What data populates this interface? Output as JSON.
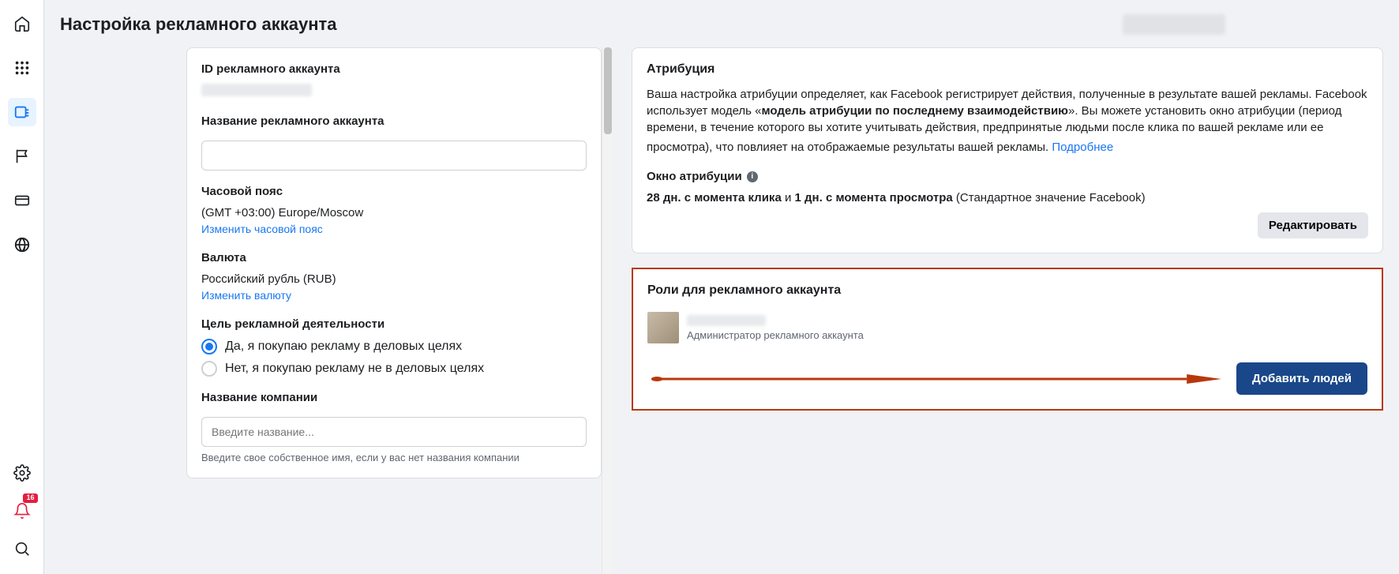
{
  "page_title": "Настройка рекламного аккаунта",
  "badge_count": "16",
  "left": {
    "id_label": "ID рекламного аккаунта",
    "name_label": "Название рекламного аккаунта",
    "tz_label": "Часовой пояс",
    "tz_value": "(GMT +03:00) Europe/Moscow",
    "tz_change": "Изменить часовой пояс",
    "currency_label": "Валюта",
    "currency_value": "Российский рубль (RUB)",
    "currency_change": "Изменить валюту",
    "purpose_label": "Цель рекламной деятельности",
    "radio_yes": "Да, я покупаю рекламу в деловых целях",
    "radio_no": "Нет, я покупаю рекламу не в деловых целях",
    "company_label": "Название компании",
    "company_placeholder": "Введите название...",
    "company_helper": "Введите свое собственное имя, если у вас нет названия компании"
  },
  "attrib": {
    "title": "Атрибуция",
    "desc_pre": "Ваша настройка атрибуции определяет, как Facebook регистрирует действия, полученные в результате вашей рекламы. Facebook использует модель «",
    "desc_bold": "модель атрибуции по последнему взаимодействию",
    "desc_post": "». Вы можете установить окно атрибуции (период времени, в течение которого вы хотите учитывать действия, предпринятые людьми после клика по вашей рекламе или ее просмотра), что повлияет на отображаемые результаты вашей рекламы. ",
    "more": "Подробнее",
    "window_label": "Окно атрибуции",
    "val_click": "28 дн. с момента клика",
    "conj": " и ",
    "val_view": "1 дн. с момента просмотра",
    "std": " (Стандартное значение Facebook)",
    "edit": "Редактировать"
  },
  "roles": {
    "title": "Роли для рекламного аккаунта",
    "role_name": "Администратор рекламного аккаунта",
    "add": "Добавить людей"
  }
}
